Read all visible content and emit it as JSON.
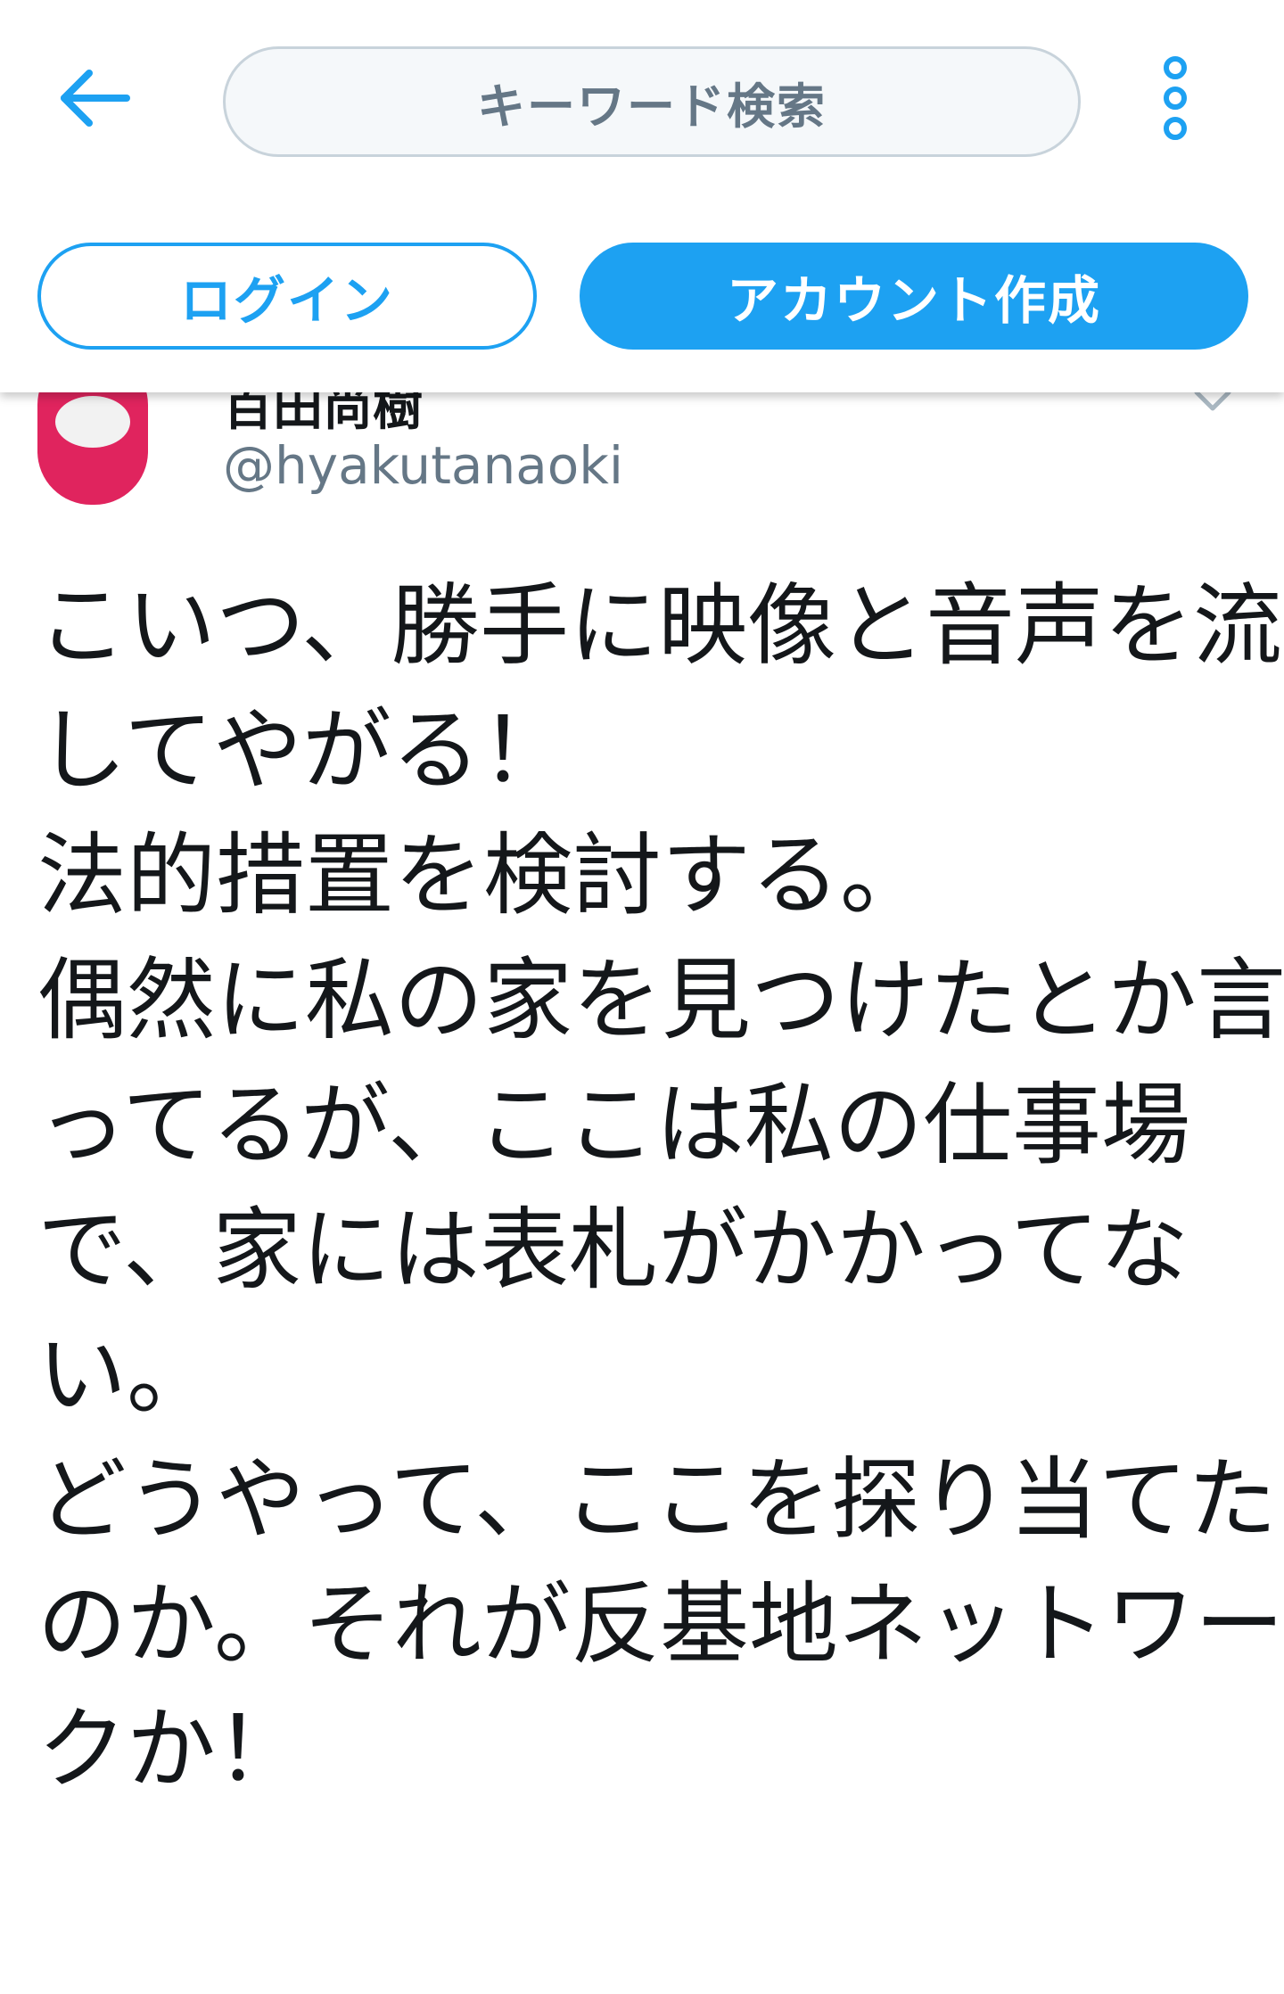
{
  "header": {
    "search_placeholder": "キーワード検索",
    "login_label": "ログイン",
    "signup_label": "アカウント作成"
  },
  "tweet": {
    "display_name": "百田尚樹",
    "handle": "@hyakutanaoki",
    "lines": [
      "こいつ、勝手に映像と音声を流",
      "してやがる！",
      "法的措置を検討する。",
      "偶然に私の家を見つけたとか言",
      "ってるが、ここは私の仕事場",
      "で、家には表札がかかってな",
      "い。",
      "どうやって、ここを探り当てた",
      "のか。それが反基地ネットワー",
      "クか！"
    ]
  },
  "colors": {
    "accent": "#1da1f2",
    "avatar": "#e0245e",
    "secondary_text": "#657786",
    "primary_text": "#14171a"
  },
  "icons": {
    "back": "arrow-left-icon",
    "menu": "more-vertical-icon",
    "caret": "chevron-down-icon"
  }
}
